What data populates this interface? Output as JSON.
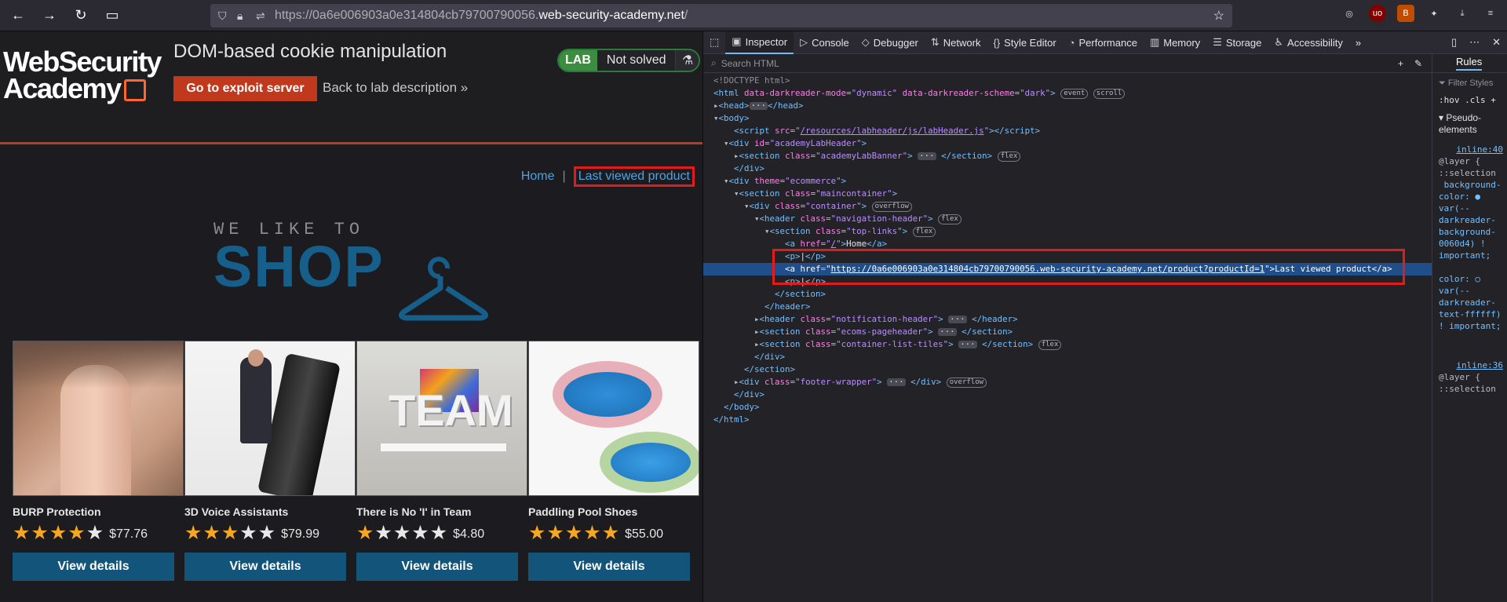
{
  "browser": {
    "url_prefix": "https://0a6e006903a0e314804cb79700790056.",
    "url_host": "web-security-academy.net",
    "url_suffix": "/"
  },
  "lab": {
    "logo_line1": "WebSecurity",
    "logo_line2": "Academy",
    "title": "DOM-based cookie manipulation",
    "exploit_button": "Go to exploit server",
    "back_link": "Back to lab description",
    "badge": "LAB",
    "status": "Not solved"
  },
  "shop": {
    "nav_home": "Home",
    "nav_separator": "|",
    "nav_last_viewed": "Last viewed product",
    "banner_small": "WE LIKE TO",
    "banner_big": "SHOP",
    "products": [
      {
        "name": "BURP Protection",
        "stars": 4,
        "price": "$77.76",
        "button": "View details"
      },
      {
        "name": "3D Voice Assistants",
        "stars": 3,
        "price": "$79.99",
        "button": "View details"
      },
      {
        "name": "There is No 'I' in Team",
        "stars": 1,
        "price": "$4.80",
        "button": "View details"
      },
      {
        "name": "Paddling Pool Shoes",
        "stars": 5,
        "price": "$55.00",
        "button": "View details"
      }
    ]
  },
  "devtools": {
    "tabs": [
      "Inspector",
      "Console",
      "Debugger",
      "Network",
      "Style Editor",
      "Performance",
      "Memory",
      "Storage",
      "Accessibility"
    ],
    "search_placeholder": "Search HTML",
    "rules_tab": "Rules",
    "filter_placeholder": "Filter Styles",
    "hov": ":hov",
    "cls": ".cls",
    "pseudo": "Pseudo-elements",
    "inline40": "inline:40",
    "inline36": "inline:36",
    "layer": "@layer {",
    "selection": "::selection"
  }
}
